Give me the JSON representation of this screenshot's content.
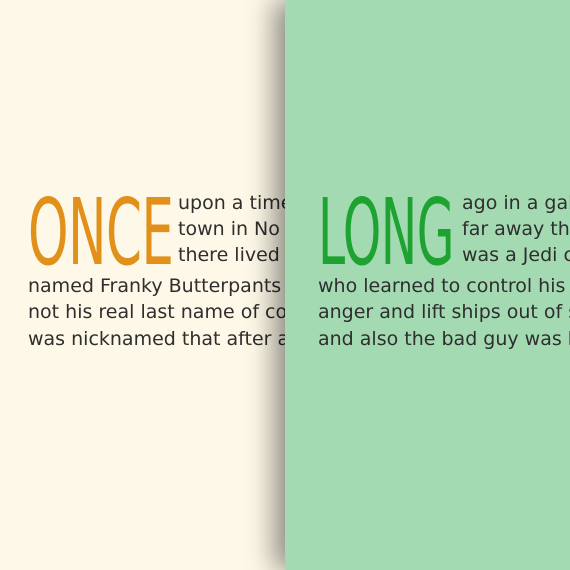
{
  "left_panel": {
    "dropcap": "ONCE",
    "wrap_lines": [
      "upon a time",
      "town in No",
      "there lived"
    ],
    "full_lines": [
      "named Franky Butterpants",
      "not his real last name of co",
      "was nicknamed that after a"
    ],
    "colors": {
      "background": "#fdf8e7",
      "dropcap": "#e1901a",
      "text": "#2e2e2e"
    }
  },
  "right_panel": {
    "dropcap": "LONG",
    "wrap_lines": [
      "ago in a gal",
      "far away th",
      "was a Jedi c"
    ],
    "full_lines": [
      "who learned to control his",
      "anger and lift ships out of s",
      "and also the bad guy was h"
    ],
    "colors": {
      "background": "#a3dab2",
      "dropcap": "#1ea231",
      "text": "#2e2e2e"
    }
  }
}
